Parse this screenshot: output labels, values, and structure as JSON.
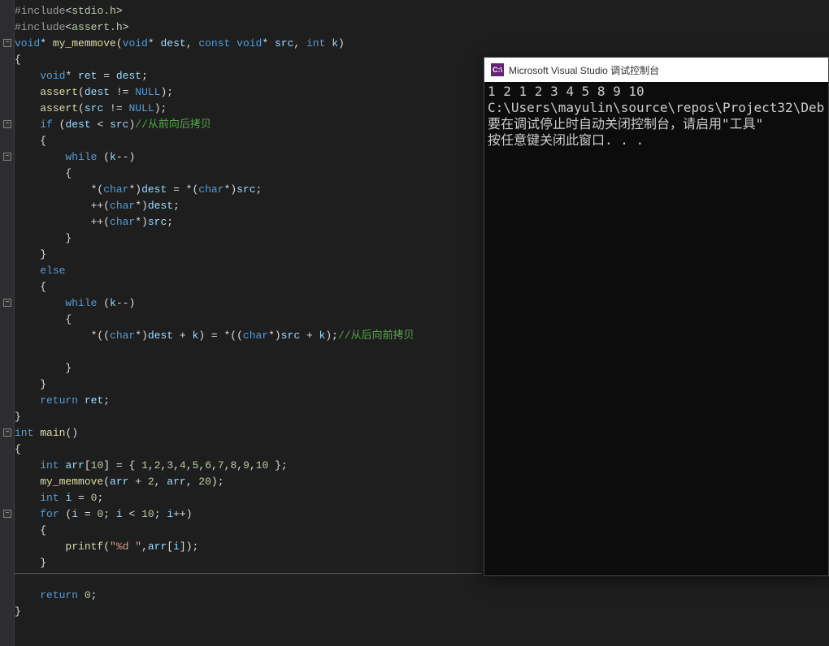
{
  "code": {
    "lines": [
      {
        "indent": 0,
        "tokens": [
          {
            "t": "hl-preproc",
            "v": "#include"
          },
          {
            "t": "hl-punct",
            "v": "<"
          },
          {
            "t": "hl-include-file",
            "v": "stdio.h"
          },
          {
            "t": "hl-punct",
            "v": ">"
          }
        ]
      },
      {
        "indent": 0,
        "tokens": [
          {
            "t": "hl-preproc",
            "v": "#include"
          },
          {
            "t": "hl-punct",
            "v": "<"
          },
          {
            "t": "hl-include-file",
            "v": "assert.h"
          },
          {
            "t": "hl-punct",
            "v": ">"
          }
        ]
      },
      {
        "indent": 0,
        "fold": true,
        "tokens": [
          {
            "t": "hl-keyword",
            "v": "void"
          },
          {
            "t": "hl-op",
            "v": "* "
          },
          {
            "t": "hl-func",
            "v": "my_memmove"
          },
          {
            "t": "hl-punct",
            "v": "("
          },
          {
            "t": "hl-keyword",
            "v": "void"
          },
          {
            "t": "hl-op",
            "v": "* "
          },
          {
            "t": "hl-param",
            "v": "dest"
          },
          {
            "t": "hl-punct",
            "v": ", "
          },
          {
            "t": "hl-keyword",
            "v": "const"
          },
          {
            "t": "hl-op",
            "v": " "
          },
          {
            "t": "hl-keyword",
            "v": "void"
          },
          {
            "t": "hl-op",
            "v": "* "
          },
          {
            "t": "hl-param",
            "v": "src"
          },
          {
            "t": "hl-punct",
            "v": ", "
          },
          {
            "t": "hl-keyword",
            "v": "int"
          },
          {
            "t": "hl-op",
            "v": " "
          },
          {
            "t": "hl-param",
            "v": "k"
          },
          {
            "t": "hl-punct",
            "v": ")"
          }
        ]
      },
      {
        "indent": 0,
        "tokens": [
          {
            "t": "hl-punct",
            "v": "{"
          }
        ]
      },
      {
        "indent": 1,
        "tokens": [
          {
            "t": "hl-keyword",
            "v": "void"
          },
          {
            "t": "hl-op",
            "v": "* "
          },
          {
            "t": "hl-var",
            "v": "ret"
          },
          {
            "t": "hl-op",
            "v": " = "
          },
          {
            "t": "hl-var",
            "v": "dest"
          },
          {
            "t": "hl-punct",
            "v": ";"
          }
        ]
      },
      {
        "indent": 1,
        "tokens": [
          {
            "t": "hl-func",
            "v": "assert"
          },
          {
            "t": "hl-punct",
            "v": "("
          },
          {
            "t": "hl-var",
            "v": "dest"
          },
          {
            "t": "hl-op",
            "v": " != "
          },
          {
            "t": "hl-null",
            "v": "NULL"
          },
          {
            "t": "hl-punct",
            "v": ");"
          }
        ]
      },
      {
        "indent": 1,
        "tokens": [
          {
            "t": "hl-func",
            "v": "assert"
          },
          {
            "t": "hl-punct",
            "v": "("
          },
          {
            "t": "hl-var",
            "v": "src"
          },
          {
            "t": "hl-op",
            "v": " != "
          },
          {
            "t": "hl-null",
            "v": "NULL"
          },
          {
            "t": "hl-punct",
            "v": ");"
          }
        ]
      },
      {
        "indent": 1,
        "fold": true,
        "tokens": [
          {
            "t": "hl-keyword",
            "v": "if"
          },
          {
            "t": "hl-op",
            "v": " ("
          },
          {
            "t": "hl-var",
            "v": "dest"
          },
          {
            "t": "hl-op",
            "v": " < "
          },
          {
            "t": "hl-var",
            "v": "src"
          },
          {
            "t": "hl-punct",
            "v": ")"
          },
          {
            "t": "hl-comment",
            "v": "//从前向后拷贝"
          }
        ]
      },
      {
        "indent": 1,
        "tokens": [
          {
            "t": "hl-punct",
            "v": "{"
          }
        ]
      },
      {
        "indent": 2,
        "fold": true,
        "tokens": [
          {
            "t": "hl-keyword",
            "v": "while"
          },
          {
            "t": "hl-op",
            "v": " ("
          },
          {
            "t": "hl-var",
            "v": "k"
          },
          {
            "t": "hl-op",
            "v": "--"
          },
          {
            "t": "hl-punct",
            "v": ")"
          }
        ]
      },
      {
        "indent": 2,
        "tokens": [
          {
            "t": "hl-punct",
            "v": "{"
          }
        ]
      },
      {
        "indent": 3,
        "tokens": [
          {
            "t": "hl-op",
            "v": "*("
          },
          {
            "t": "hl-keyword",
            "v": "char"
          },
          {
            "t": "hl-op",
            "v": "*)"
          },
          {
            "t": "hl-var",
            "v": "dest"
          },
          {
            "t": "hl-op",
            "v": " = *("
          },
          {
            "t": "hl-keyword",
            "v": "char"
          },
          {
            "t": "hl-op",
            "v": "*)"
          },
          {
            "t": "hl-var",
            "v": "src"
          },
          {
            "t": "hl-punct",
            "v": ";"
          }
        ]
      },
      {
        "indent": 3,
        "tokens": [
          {
            "t": "hl-op",
            "v": "++("
          },
          {
            "t": "hl-keyword",
            "v": "char"
          },
          {
            "t": "hl-op",
            "v": "*)"
          },
          {
            "t": "hl-var",
            "v": "dest"
          },
          {
            "t": "hl-punct",
            "v": ";"
          }
        ]
      },
      {
        "indent": 3,
        "tokens": [
          {
            "t": "hl-op",
            "v": "++("
          },
          {
            "t": "hl-keyword",
            "v": "char"
          },
          {
            "t": "hl-op",
            "v": "*)"
          },
          {
            "t": "hl-var",
            "v": "src"
          },
          {
            "t": "hl-punct",
            "v": ";"
          }
        ]
      },
      {
        "indent": 2,
        "tokens": [
          {
            "t": "hl-punct",
            "v": "}"
          }
        ]
      },
      {
        "indent": 1,
        "tokens": [
          {
            "t": "hl-punct",
            "v": "}"
          }
        ]
      },
      {
        "indent": 1,
        "tokens": [
          {
            "t": "hl-keyword",
            "v": "else"
          }
        ]
      },
      {
        "indent": 1,
        "tokens": [
          {
            "t": "hl-punct",
            "v": "{"
          }
        ]
      },
      {
        "indent": 2,
        "fold": true,
        "tokens": [
          {
            "t": "hl-keyword",
            "v": "while"
          },
          {
            "t": "hl-op",
            "v": " ("
          },
          {
            "t": "hl-var",
            "v": "k"
          },
          {
            "t": "hl-op",
            "v": "--"
          },
          {
            "t": "hl-punct",
            "v": ")"
          }
        ]
      },
      {
        "indent": 2,
        "tokens": [
          {
            "t": "hl-punct",
            "v": "{"
          }
        ]
      },
      {
        "indent": 3,
        "tokens": [
          {
            "t": "hl-op",
            "v": "*(("
          },
          {
            "t": "hl-keyword",
            "v": "char"
          },
          {
            "t": "hl-op",
            "v": "*)"
          },
          {
            "t": "hl-var",
            "v": "dest"
          },
          {
            "t": "hl-op",
            "v": " + "
          },
          {
            "t": "hl-var",
            "v": "k"
          },
          {
            "t": "hl-op",
            "v": ") = *(("
          },
          {
            "t": "hl-keyword",
            "v": "char"
          },
          {
            "t": "hl-op",
            "v": "*)"
          },
          {
            "t": "hl-var",
            "v": "src"
          },
          {
            "t": "hl-op",
            "v": " + "
          },
          {
            "t": "hl-var",
            "v": "k"
          },
          {
            "t": "hl-punct",
            "v": ");"
          },
          {
            "t": "hl-comment",
            "v": "//从后向前拷贝"
          }
        ]
      },
      {
        "indent": 2,
        "tokens": []
      },
      {
        "indent": 2,
        "tokens": [
          {
            "t": "hl-punct",
            "v": "}"
          }
        ]
      },
      {
        "indent": 1,
        "tokens": [
          {
            "t": "hl-punct",
            "v": "}"
          }
        ]
      },
      {
        "indent": 1,
        "tokens": [
          {
            "t": "hl-keyword",
            "v": "return"
          },
          {
            "t": "hl-op",
            "v": " "
          },
          {
            "t": "hl-var",
            "v": "ret"
          },
          {
            "t": "hl-punct",
            "v": ";"
          }
        ]
      },
      {
        "indent": 0,
        "tokens": [
          {
            "t": "hl-punct",
            "v": "}"
          }
        ]
      },
      {
        "indent": 0,
        "fold": true,
        "tokens": [
          {
            "t": "hl-keyword",
            "v": "int"
          },
          {
            "t": "hl-op",
            "v": " "
          },
          {
            "t": "hl-func",
            "v": "main"
          },
          {
            "t": "hl-punct",
            "v": "()"
          }
        ]
      },
      {
        "indent": 0,
        "tokens": [
          {
            "t": "hl-punct",
            "v": "{"
          }
        ]
      },
      {
        "indent": 1,
        "tokens": [
          {
            "t": "hl-keyword",
            "v": "int"
          },
          {
            "t": "hl-op",
            "v": " "
          },
          {
            "t": "hl-var",
            "v": "arr"
          },
          {
            "t": "hl-punct",
            "v": "["
          },
          {
            "t": "hl-number",
            "v": "10"
          },
          {
            "t": "hl-punct",
            "v": "] = { "
          },
          {
            "t": "hl-number",
            "v": "1"
          },
          {
            "t": "hl-punct",
            "v": ","
          },
          {
            "t": "hl-number",
            "v": "2"
          },
          {
            "t": "hl-punct",
            "v": ","
          },
          {
            "t": "hl-number",
            "v": "3"
          },
          {
            "t": "hl-punct",
            "v": ","
          },
          {
            "t": "hl-number",
            "v": "4"
          },
          {
            "t": "hl-punct",
            "v": ","
          },
          {
            "t": "hl-number",
            "v": "5"
          },
          {
            "t": "hl-punct",
            "v": ","
          },
          {
            "t": "hl-number",
            "v": "6"
          },
          {
            "t": "hl-punct",
            "v": ","
          },
          {
            "t": "hl-number",
            "v": "7"
          },
          {
            "t": "hl-punct",
            "v": ","
          },
          {
            "t": "hl-number",
            "v": "8"
          },
          {
            "t": "hl-punct",
            "v": ","
          },
          {
            "t": "hl-number",
            "v": "9"
          },
          {
            "t": "hl-punct",
            "v": ","
          },
          {
            "t": "hl-number",
            "v": "10"
          },
          {
            "t": "hl-punct",
            "v": " };"
          }
        ]
      },
      {
        "indent": 1,
        "tokens": [
          {
            "t": "hl-func",
            "v": "my_memmove"
          },
          {
            "t": "hl-punct",
            "v": "("
          },
          {
            "t": "hl-var",
            "v": "arr"
          },
          {
            "t": "hl-op",
            "v": " + "
          },
          {
            "t": "hl-number",
            "v": "2"
          },
          {
            "t": "hl-punct",
            "v": ", "
          },
          {
            "t": "hl-var",
            "v": "arr"
          },
          {
            "t": "hl-punct",
            "v": ", "
          },
          {
            "t": "hl-number",
            "v": "20"
          },
          {
            "t": "hl-punct",
            "v": ");"
          }
        ]
      },
      {
        "indent": 1,
        "tokens": [
          {
            "t": "hl-keyword",
            "v": "int"
          },
          {
            "t": "hl-op",
            "v": " "
          },
          {
            "t": "hl-var",
            "v": "i"
          },
          {
            "t": "hl-op",
            "v": " = "
          },
          {
            "t": "hl-number",
            "v": "0"
          },
          {
            "t": "hl-punct",
            "v": ";"
          }
        ]
      },
      {
        "indent": 1,
        "fold": true,
        "tokens": [
          {
            "t": "hl-keyword",
            "v": "for"
          },
          {
            "t": "hl-op",
            "v": " ("
          },
          {
            "t": "hl-var",
            "v": "i"
          },
          {
            "t": "hl-op",
            "v": " = "
          },
          {
            "t": "hl-number",
            "v": "0"
          },
          {
            "t": "hl-punct",
            "v": "; "
          },
          {
            "t": "hl-var",
            "v": "i"
          },
          {
            "t": "hl-op",
            "v": " < "
          },
          {
            "t": "hl-number",
            "v": "10"
          },
          {
            "t": "hl-punct",
            "v": "; "
          },
          {
            "t": "hl-var",
            "v": "i"
          },
          {
            "t": "hl-op",
            "v": "++"
          },
          {
            "t": "hl-punct",
            "v": ")"
          }
        ]
      },
      {
        "indent": 1,
        "tokens": [
          {
            "t": "hl-punct",
            "v": "{"
          }
        ]
      },
      {
        "indent": 2,
        "tokens": [
          {
            "t": "hl-func",
            "v": "printf"
          },
          {
            "t": "hl-punct",
            "v": "("
          },
          {
            "t": "hl-string",
            "v": "\"%d \""
          },
          {
            "t": "hl-punct",
            "v": ","
          },
          {
            "t": "hl-var",
            "v": "arr"
          },
          {
            "t": "hl-punct",
            "v": "["
          },
          {
            "t": "hl-var",
            "v": "i"
          },
          {
            "t": "hl-punct",
            "v": "]);"
          }
        ]
      },
      {
        "indent": 1,
        "tokens": [
          {
            "t": "hl-punct",
            "v": "}"
          }
        ]
      },
      {
        "indent": 0,
        "tokens": []
      },
      {
        "indent": 1,
        "tokens": [
          {
            "t": "hl-keyword",
            "v": "return"
          },
          {
            "t": "hl-op",
            "v": " "
          },
          {
            "t": "hl-number",
            "v": "0"
          },
          {
            "t": "hl-punct",
            "v": ";"
          }
        ]
      },
      {
        "indent": 0,
        "tokens": [
          {
            "t": "hl-punct",
            "v": "}"
          }
        ]
      }
    ]
  },
  "console": {
    "icon_text": "C:\\",
    "title": "Microsoft Visual Studio 调试控制台",
    "lines": [
      "1 2 1 2 3 4 5 8 9 10",
      "C:\\Users\\mayulin\\source\\repos\\Project32\\Deb",
      "要在调试停止时自动关闭控制台，请启用\"工具\"",
      "按任意键关闭此窗口. . ."
    ]
  }
}
